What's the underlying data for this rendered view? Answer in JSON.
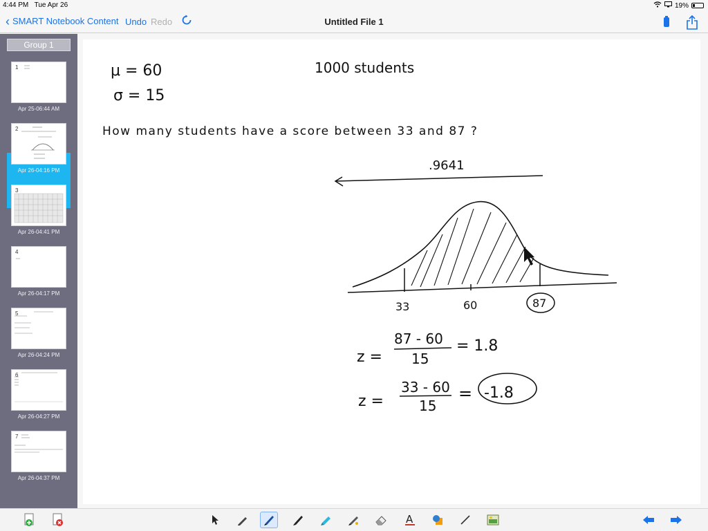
{
  "status": {
    "time": "4:44 PM",
    "date": "Tue Apr 26",
    "battery": "19%"
  },
  "nav": {
    "back_label": "SMART Notebook Content",
    "undo_label": "Undo",
    "redo_label": "Redo",
    "title": "Untitled File 1"
  },
  "sidebar": {
    "group_label": "Group 1",
    "pages": [
      {
        "num": "1",
        "date": "Apr 25-06:44 AM"
      },
      {
        "num": "2",
        "date": "Apr 26-04:16 PM",
        "selected": true
      },
      {
        "num": "3",
        "date": "Apr 26-04:41 PM"
      },
      {
        "num": "4",
        "date": "Apr 26-04:17 PM"
      },
      {
        "num": "5",
        "date": "Apr 26-04:24 PM"
      },
      {
        "num": "6",
        "date": "Apr 26-04:27 PM"
      },
      {
        "num": "7",
        "date": "Apr 26-04:37 PM"
      }
    ]
  },
  "notes": {
    "mu": "μ = 60",
    "sigma": "σ = 15",
    "students": "1000 students",
    "question": "How many students have a score between 33 and 87 ?",
    "area": ".9641",
    "tick_left": "33",
    "tick_mid": "60",
    "tick_right": "87",
    "z1_lhs": "z =",
    "z1_num": "87 - 60",
    "z1_den": "15",
    "z1_res": "= 1.8",
    "z2_lhs": "z =",
    "z2_num": "33 - 60",
    "z2_den": "15",
    "z2_res": "=",
    "z2_val": "-1.8"
  }
}
